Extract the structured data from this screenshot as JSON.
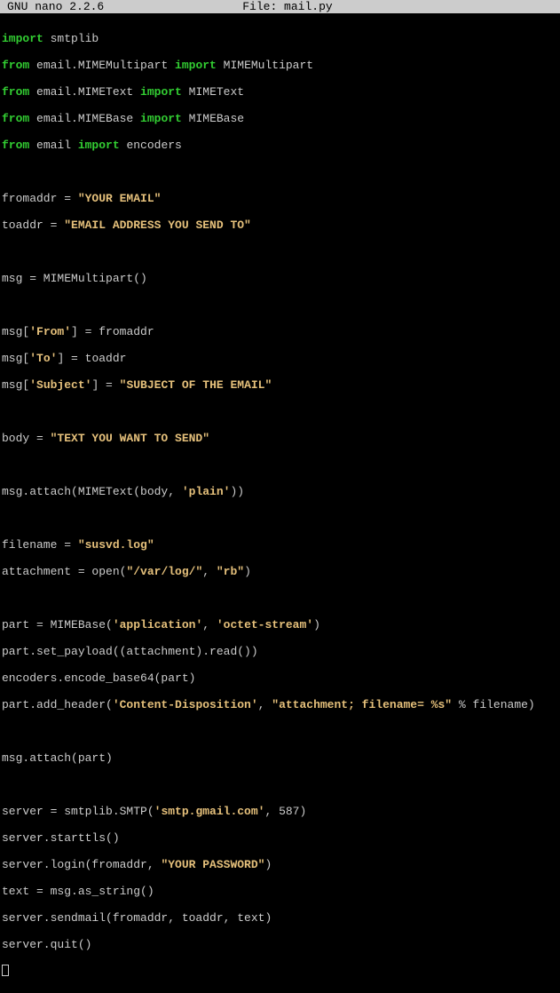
{
  "titlebar": {
    "app": "GNU nano 2.2.6",
    "file_label": "File: mail.py"
  },
  "code": {
    "l01_kw1": "import",
    "l01_rest": " smtplib",
    "l02_kw1": "from",
    "l02_mid": " email.MIMEMultipart ",
    "l02_kw2": "import",
    "l02_rest": " MIMEMultipart",
    "l03_kw1": "from",
    "l03_mid": " email.MIMEText ",
    "l03_kw2": "import",
    "l03_rest": " MIMEText",
    "l04_kw1": "from",
    "l04_mid": " email.MIMEBase ",
    "l04_kw2": "import",
    "l04_rest": " MIMEBase",
    "l05_kw1": "from",
    "l05_mid": " email ",
    "l05_kw2": "import",
    "l05_rest": " encoders",
    "l07_a": "fromaddr = ",
    "l07_s": "\"YOUR EMAIL\"",
    "l08_a": "toaddr = ",
    "l08_s": "\"EMAIL ADDRESS YOU SEND TO\"",
    "l10": "msg = MIMEMultipart()",
    "l12_a": "msg[",
    "l12_s": "'From'",
    "l12_c": "] = fromaddr",
    "l13_a": "msg[",
    "l13_s": "'To'",
    "l13_c": "] = toaddr",
    "l14_a": "msg[",
    "l14_s": "'Subject'",
    "l14_c": "] = ",
    "l14_s2": "\"SUBJECT OF THE EMAIL\"",
    "l16_a": "body = ",
    "l16_s": "\"TEXT YOU WANT TO SEND\"",
    "l18_a": "msg.attach(MIMEText(body, ",
    "l18_s": "'plain'",
    "l18_c": "))",
    "l20_a": "filename = ",
    "l20_s": "\"susvd.log\"",
    "l21_a": "attachment = open(",
    "l21_s": "\"/var/log/\"",
    "l21_c": ", ",
    "l21_s2": "\"rb\"",
    "l21_d": ")",
    "l23_a": "part = MIMEBase(",
    "l23_s": "'application'",
    "l23_c": ", ",
    "l23_s2": "'octet-stream'",
    "l23_d": ")",
    "l24": "part.set_payload((attachment).read())",
    "l25": "encoders.encode_base64(part)",
    "l26_a": "part.add_header(",
    "l26_s": "'Content-Disposition'",
    "l26_c": ", ",
    "l26_s2": "\"attachment; filename= %s\"",
    "l26_d": " % filename)",
    "l28": "msg.attach(part)",
    "l30_a": "server = smtplib.SMTP(",
    "l30_s": "'smtp.gmail.com'",
    "l30_c": ", 587)",
    "l31": "server.starttls()",
    "l32_a": "server.login(fromaddr, ",
    "l32_s": "\"YOUR PASSWORD\"",
    "l32_c": ")",
    "l33": "text = msg.as_string()",
    "l34": "server.sendmail(fromaddr, toaddr, text)",
    "l35": "server.quit()"
  }
}
